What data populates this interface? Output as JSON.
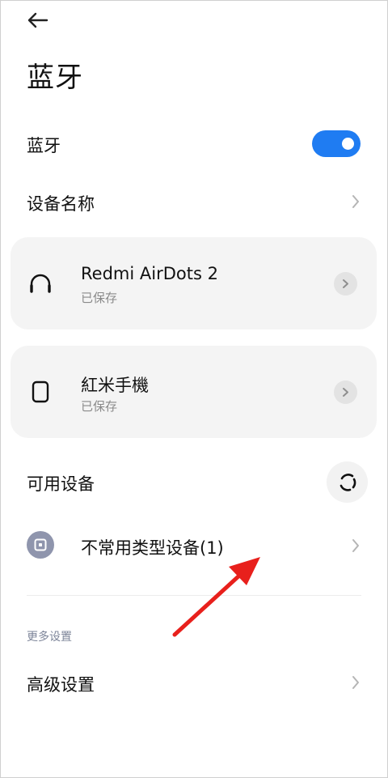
{
  "header": {
    "back_icon": "arrow-left-icon",
    "title": "蓝牙"
  },
  "bluetooth_toggle": {
    "label": "蓝牙",
    "state": "on",
    "color": "#1f7cf2"
  },
  "device_name_row": {
    "label": "设备名称"
  },
  "saved_devices": [
    {
      "name": "Redmi AirDots 2",
      "status": "已保存",
      "icon": "headphones-icon"
    },
    {
      "name": "紅米手機",
      "status": "已保存",
      "icon": "phone-icon"
    }
  ],
  "available_devices": {
    "label": "可用设备",
    "refresh_icon": "refresh-icon",
    "items": [
      {
        "label": "不常用类型设备(1)",
        "icon": "unknown-device-icon"
      }
    ]
  },
  "more_settings": {
    "section_label": "更多设置",
    "items": [
      {
        "label": "高级设置"
      }
    ]
  },
  "annotation": {
    "color": "#e8201c",
    "icon": "red-annotation-arrow"
  }
}
